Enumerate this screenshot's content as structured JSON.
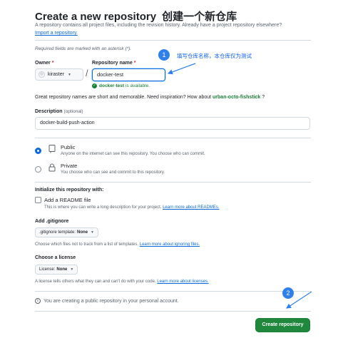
{
  "header": {
    "title": "Create a new repository",
    "title_cn": "创建一个新仓库",
    "subtitle": "A repository contains all project files, including the revision history. Already have a project repository elsewhere?",
    "import_link": "Import a repository."
  },
  "form": {
    "required_note": "Required fields are marked with an asterisk (*).",
    "owner_label": "Owner",
    "owner_value": "kiraster",
    "repo_label": "Repository name",
    "repo_value": "docker-test",
    "availability_name": "docker-test",
    "availability_text": "is available.",
    "inspiration": "Great repository names are short and memorable. Need inspiration? How about",
    "suggestion": "urban-octo-fishstick",
    "suggestion_suffix": "?",
    "description_label": "Description",
    "description_optional": "(optional)",
    "description_value": "docker-build-push-action",
    "visibility": [
      {
        "title": "Public",
        "desc": "Anyone on the internet can see this repository. You choose who can commit.",
        "selected": true
      },
      {
        "title": "Private",
        "desc": "You choose who can see and commit to this repository.",
        "selected": false
      }
    ],
    "init_label": "Initialize this repository with:",
    "readme_label": "Add a README file",
    "readme_help": "This is where you can write a long description for your project.",
    "readme_link": "Learn more about READMEs.",
    "gitignore_label": "Add .gitignore",
    "gitignore_select_prefix": ".gitignore template:",
    "gitignore_select_value": "None",
    "gitignore_help": "Choose which files not to track from a list of templates.",
    "gitignore_link": "Learn more about ignoring files.",
    "license_label": "Choose a license",
    "license_select_prefix": "License:",
    "license_select_value": "None",
    "license_help": "A license tells others what they can and can't do with your code.",
    "license_link": "Learn more about licenses.",
    "info_text": "You are creating a public repository in your personal account.",
    "create_button": "Create repository"
  },
  "annotations": {
    "step1": "1",
    "step1_text": "填写仓库名称，本仓库仅为测试",
    "step2": "2",
    "color": "#2f80ed"
  }
}
